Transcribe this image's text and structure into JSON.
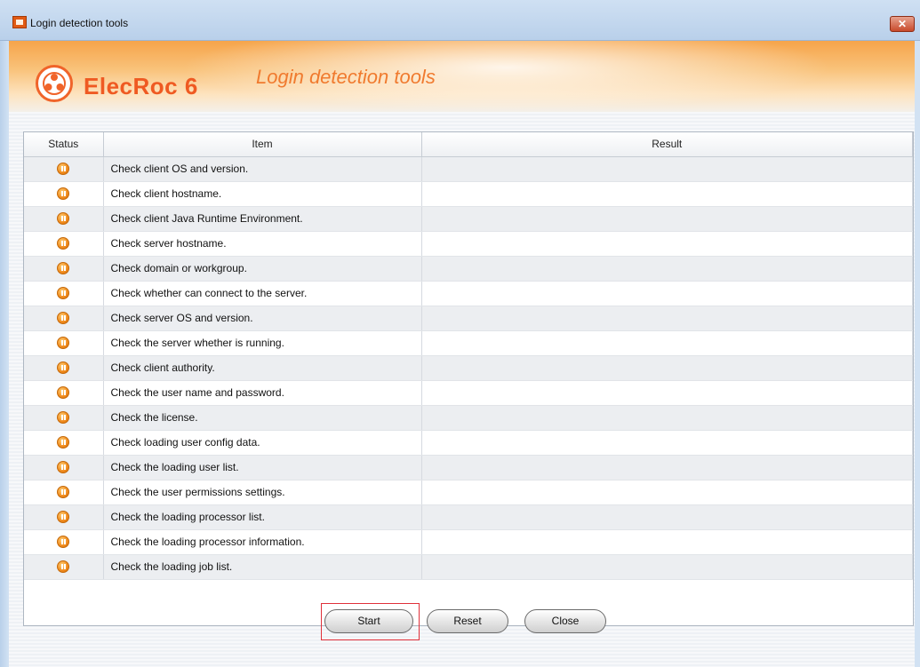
{
  "window": {
    "title": "Login detection tools",
    "close_glyph": "✕"
  },
  "banner": {
    "brand": "ElecRoc 6",
    "subtitle": "Login detection tools",
    "logo_icon": "elecroc-logo-icon"
  },
  "table": {
    "columns": [
      "Status",
      "Item",
      "Result"
    ],
    "rows": [
      {
        "status": "pending",
        "item": "Check client OS and version.",
        "result": ""
      },
      {
        "status": "pending",
        "item": "Check client hostname.",
        "result": ""
      },
      {
        "status": "pending",
        "item": "Check client Java Runtime Environment.",
        "result": ""
      },
      {
        "status": "pending",
        "item": "Check server hostname.",
        "result": ""
      },
      {
        "status": "pending",
        "item": "Check domain or workgroup.",
        "result": ""
      },
      {
        "status": "pending",
        "item": "Check whether can connect to the server.",
        "result": ""
      },
      {
        "status": "pending",
        "item": "Check server OS and version.",
        "result": ""
      },
      {
        "status": "pending",
        "item": "Check the server whether is running.",
        "result": ""
      },
      {
        "status": "pending",
        "item": "Check client authority.",
        "result": ""
      },
      {
        "status": "pending",
        "item": "Check the user name and password.",
        "result": ""
      },
      {
        "status": "pending",
        "item": "Check the license.",
        "result": ""
      },
      {
        "status": "pending",
        "item": "Check loading user config data.",
        "result": ""
      },
      {
        "status": "pending",
        "item": "Check the loading user list.",
        "result": ""
      },
      {
        "status": "pending",
        "item": "Check the user permissions settings.",
        "result": ""
      },
      {
        "status": "pending",
        "item": "Check the loading processor list.",
        "result": ""
      },
      {
        "status": "pending",
        "item": "Check the loading processor information.",
        "result": ""
      },
      {
        "status": "pending",
        "item": "Check the loading job list.",
        "result": ""
      }
    ]
  },
  "buttons": {
    "start": "Start",
    "reset": "Reset",
    "close": "Close"
  },
  "colors": {
    "brand": "#ef5a22",
    "subtitle": "#f07a2e",
    "status_pending": "#f08a1c",
    "focus_outline": "#e0303a"
  }
}
